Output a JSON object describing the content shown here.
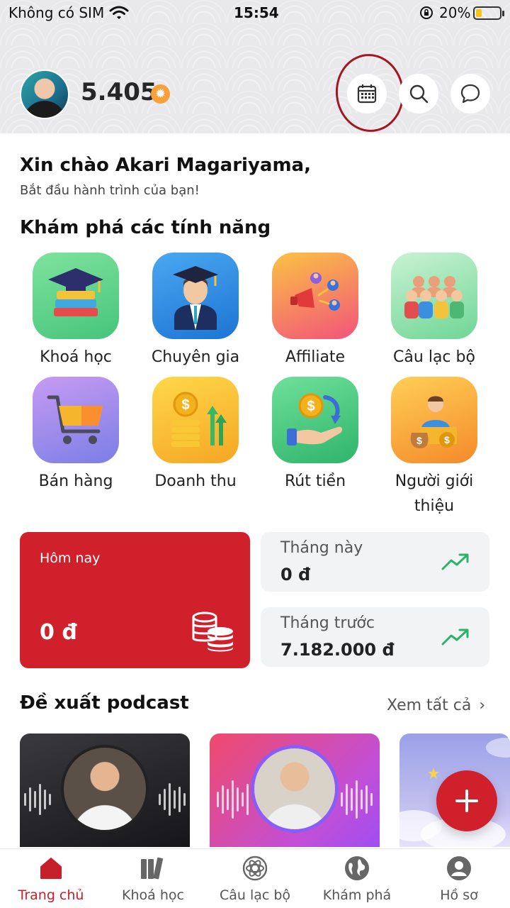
{
  "status_bar": {
    "carrier": "Không có SIM",
    "time": "15:54",
    "battery_percent": "20%"
  },
  "header": {
    "points": "5.405",
    "points_icon": "coin-icon",
    "buttons": [
      "calendar-icon",
      "search-icon",
      "chat-icon"
    ]
  },
  "greeting": {
    "title": "Xin chào Akari Magariyama,",
    "subtitle": "Bắt đầu hành trình của bạn!"
  },
  "features": {
    "title": "Khám phá các tính năng",
    "items": [
      {
        "label": "Khoá học",
        "icon": "graduation-books-icon",
        "color": "#5fc98a"
      },
      {
        "label": "Chuyên gia",
        "icon": "graduate-person-icon",
        "color": "#2d8fe6"
      },
      {
        "label": "Affiliate",
        "icon": "megaphone-network-icon",
        "color": "#f6a347"
      },
      {
        "label": "Câu lạc bộ",
        "icon": "group-people-icon",
        "color": "#5fd08f"
      },
      {
        "label": "Bán hàng",
        "icon": "shopping-cart-icon",
        "color": "#8f86e8"
      },
      {
        "label": "Doanh thu",
        "icon": "revenue-coins-icon",
        "color": "#f7b73c"
      },
      {
        "label": "Rút tiền",
        "icon": "withdraw-coin-hand-icon",
        "color": "#45c37c"
      },
      {
        "label": "Người giới\nthiệu",
        "icon": "referrer-money-icon",
        "color": "#f4a13b"
      }
    ]
  },
  "stats": {
    "today": {
      "label": "Hôm nay",
      "amount": "0 đ",
      "icon": "coins-stack-icon"
    },
    "this_month": {
      "label": "Tháng này",
      "amount": "0 đ",
      "icon": "trend-up-icon"
    },
    "last_month": {
      "label": "Tháng trước",
      "amount": "7.182.000 đ",
      "icon": "trend-up-icon"
    }
  },
  "podcast": {
    "title": "Đề xuất podcast",
    "see_all": "Xem tất cả"
  },
  "bottom_nav": [
    {
      "label": "Trang chủ",
      "icon": "home-icon",
      "active": true
    },
    {
      "label": "Khoá học",
      "icon": "books-icon",
      "active": false
    },
    {
      "label": "Câu lạc bộ",
      "icon": "atom-icon",
      "active": false
    },
    {
      "label": "Khám phá",
      "icon": "globe-icon",
      "active": false
    },
    {
      "label": "Hồ sơ",
      "icon": "profile-icon",
      "active": false
    }
  ],
  "colors": {
    "accent": "#d0202c",
    "active_nav": "#c8202b",
    "trend": "#2bb36a"
  }
}
